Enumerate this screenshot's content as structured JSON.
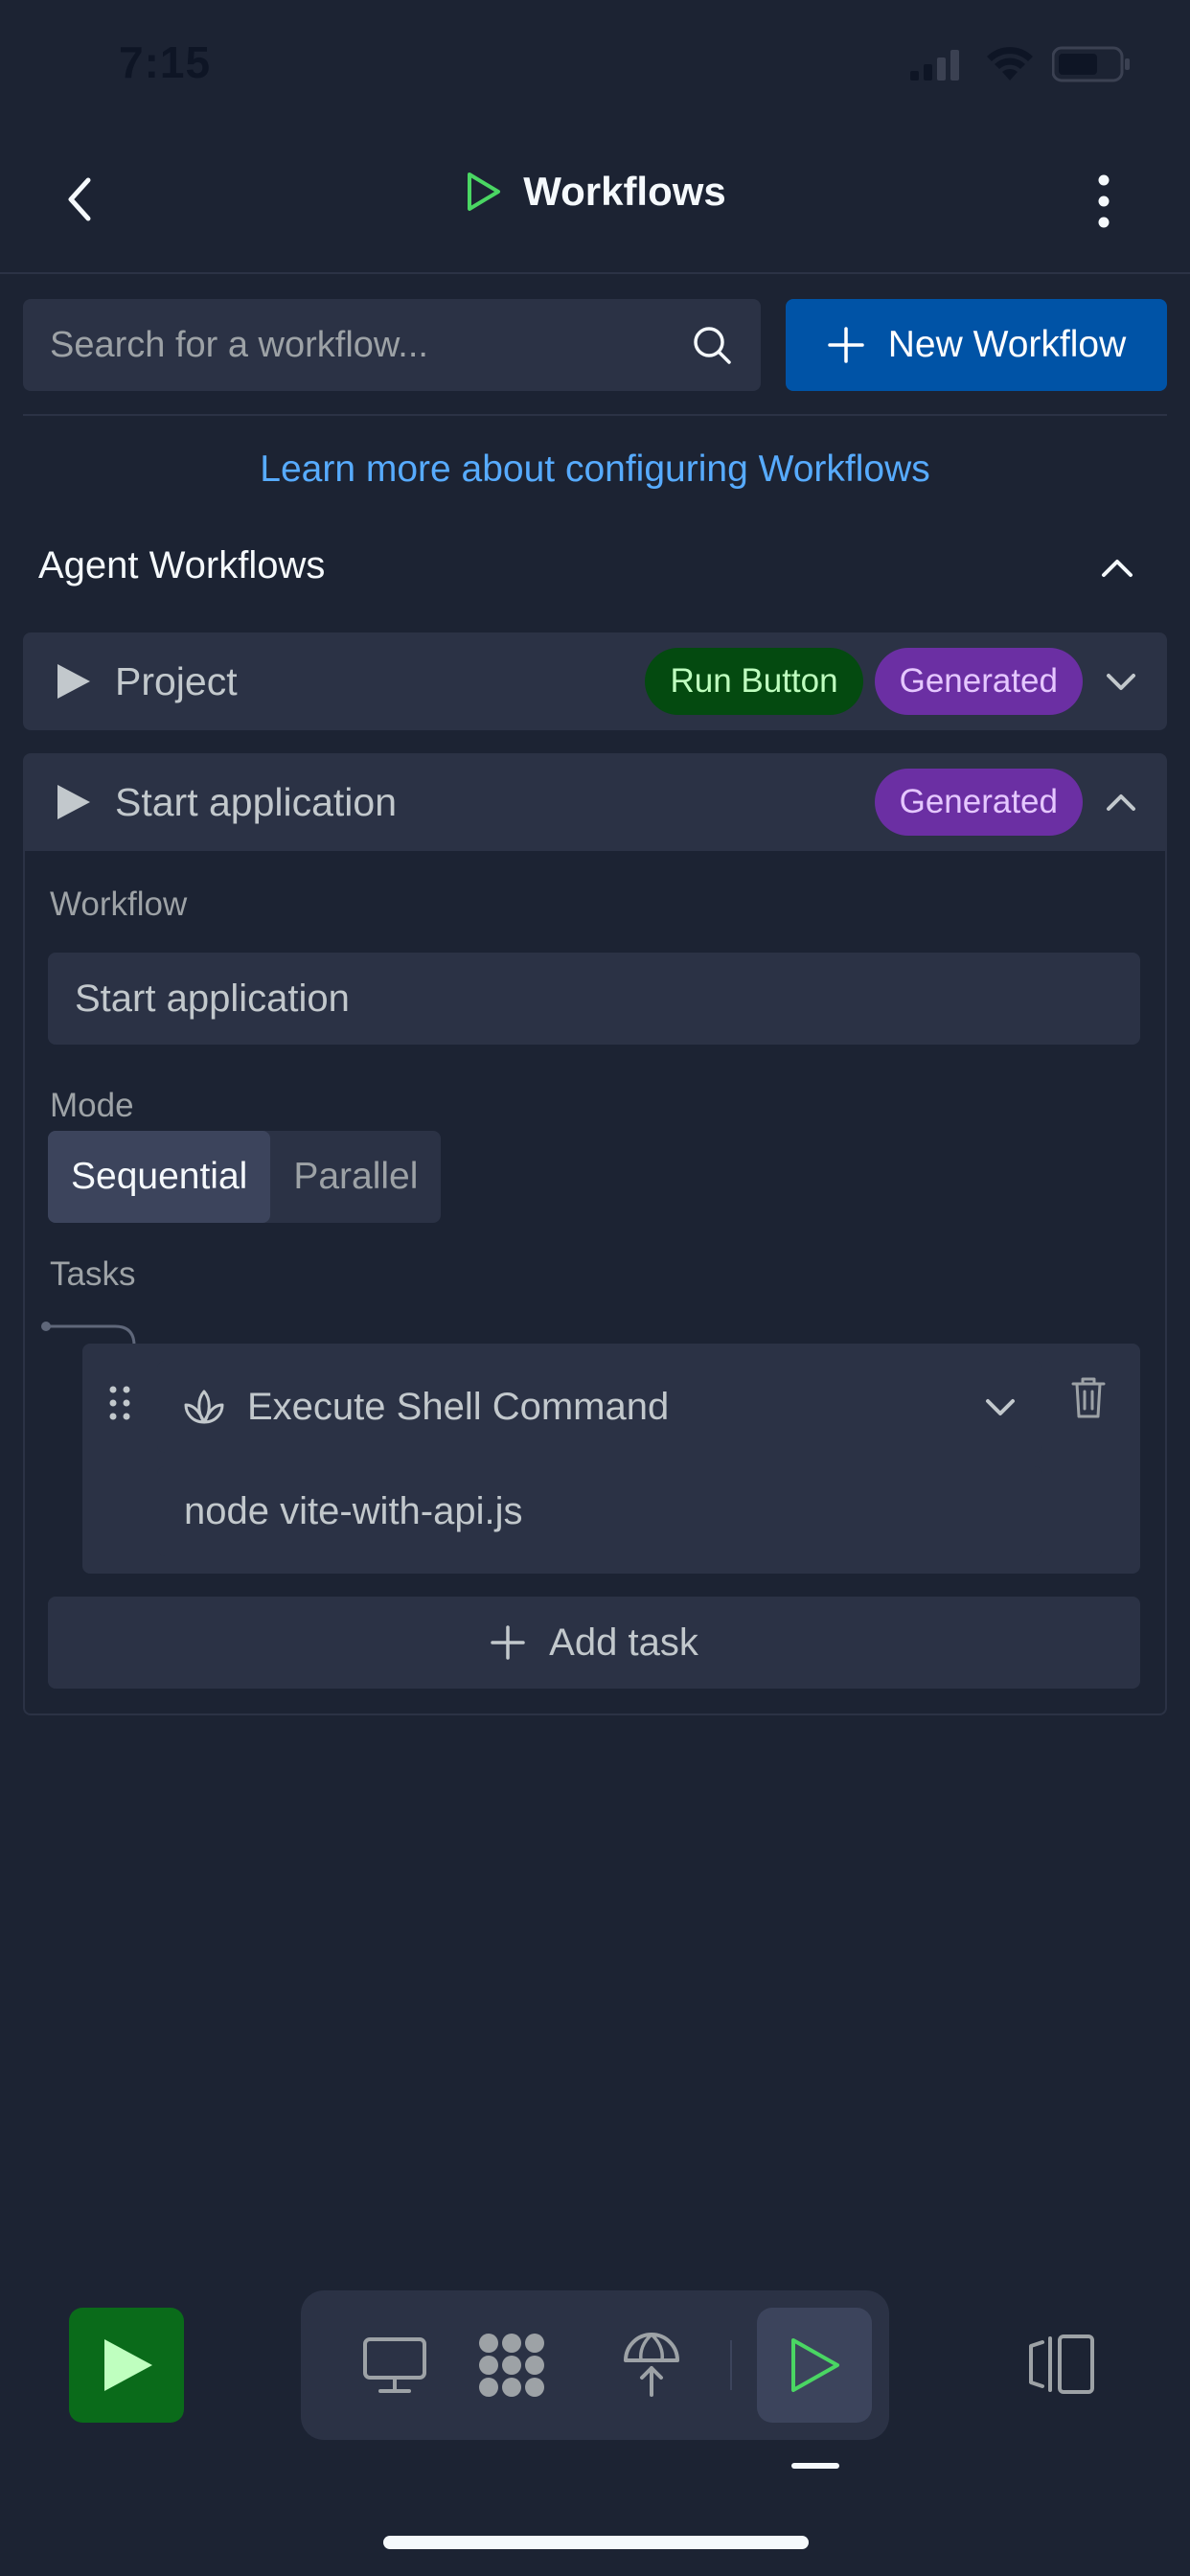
{
  "status_bar": {
    "time": "7:15",
    "icons": [
      "cellular-signal-icon",
      "wifi-icon",
      "battery-icon"
    ]
  },
  "header": {
    "title": "Workflows",
    "back_icon": "chevron-left-icon",
    "title_icon": "play-icon",
    "menu_icon": "more-vertical-icon"
  },
  "search": {
    "placeholder": "Search for a workflow...",
    "value": "",
    "icon": "search-icon"
  },
  "new_workflow": {
    "label": "New Workflow",
    "icon": "plus-icon"
  },
  "learn_more": {
    "text": "Learn more about configuring Workflows"
  },
  "section": {
    "title": "Agent Workflows",
    "expanded": true
  },
  "workflows": [
    {
      "name": "Project",
      "badges": [
        "Run Button",
        "Generated"
      ],
      "expanded": false
    },
    {
      "name": "Start application",
      "badges": [
        "Generated"
      ],
      "expanded": true
    }
  ],
  "editor": {
    "workflow_label": "Workflow",
    "workflow_name": "Start application",
    "mode_label": "Mode",
    "modes": [
      "Sequential",
      "Parallel"
    ],
    "selected_mode": "Sequential",
    "tasks_label": "Tasks",
    "tasks": [
      {
        "type": "Execute Shell Command",
        "command": "node vite-with-api.js"
      }
    ],
    "add_task_label": "Add task"
  },
  "bottom_nav": {
    "run_icon": "play-icon",
    "dock_items": [
      "monitor-icon",
      "packages-icon",
      "deploy-icon",
      "workflows-icon"
    ],
    "active_item": "workflows-icon",
    "panel_icon": "layout-panels-icon"
  },
  "colors": {
    "background": "#1c2333",
    "surface": "#2b3245",
    "primary": "#0053a6",
    "link": "#57abff",
    "run_green": "#0a6b1a",
    "badge_green": "#044a10",
    "badge_purple": "#6b2fa3"
  }
}
